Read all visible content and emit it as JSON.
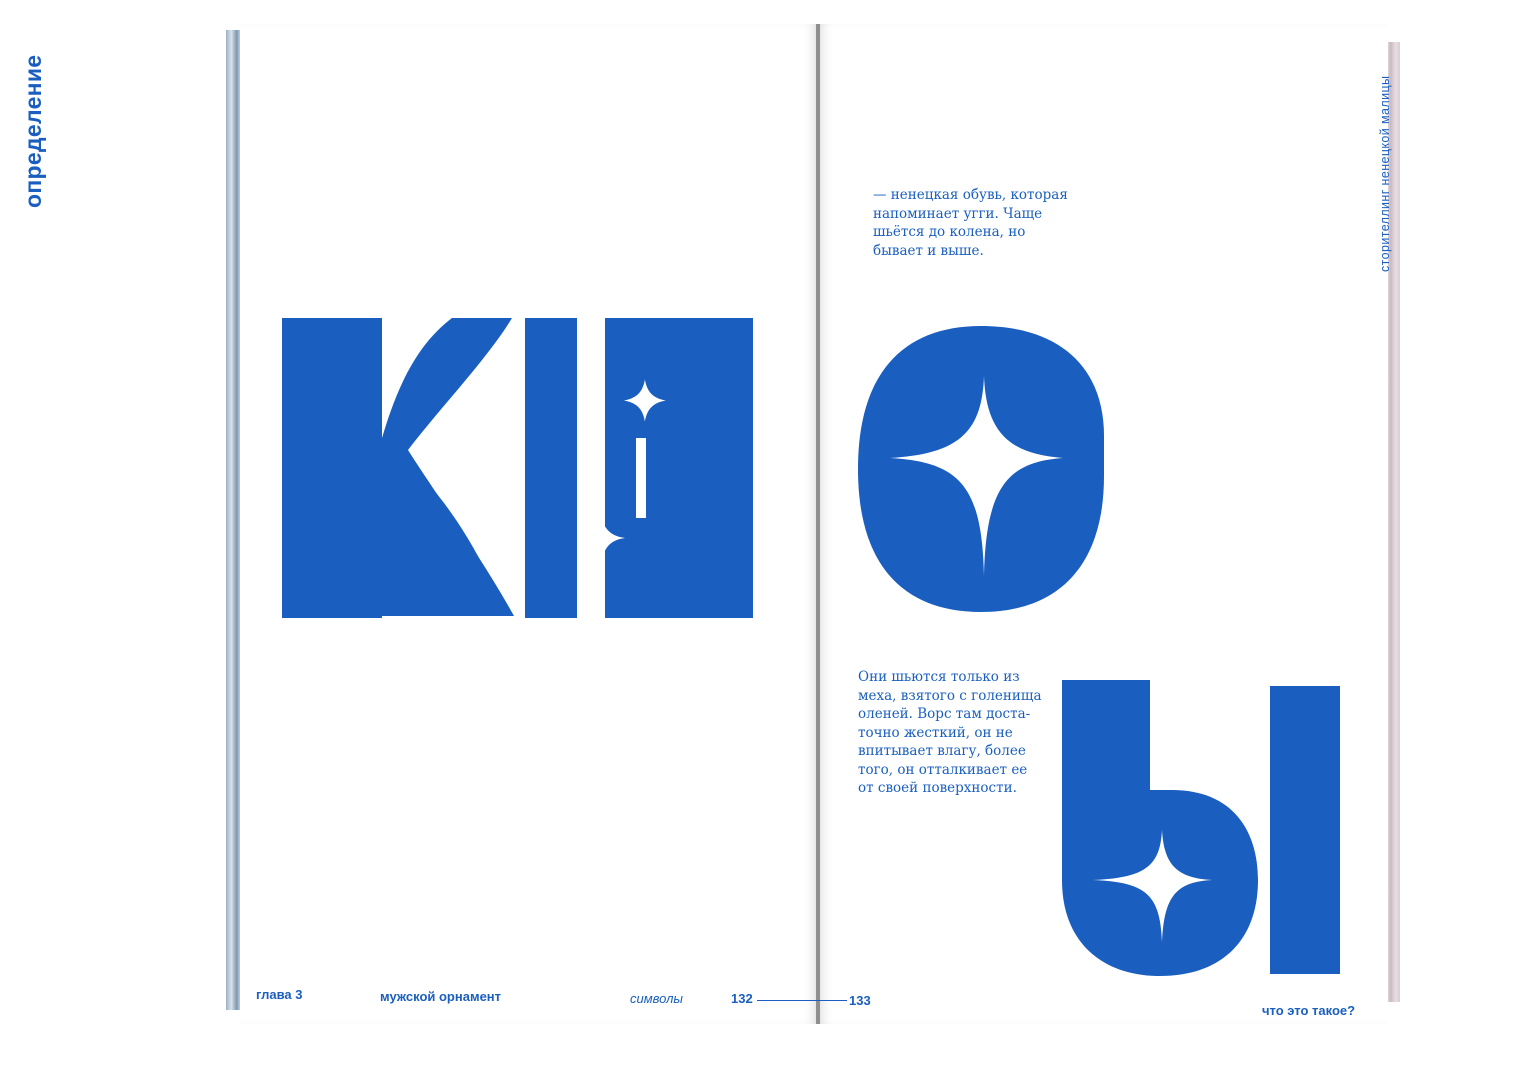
{
  "left_page": {
    "section_label": "определение",
    "footer": {
      "chapter": "глава 3",
      "topic": "мужской орнамент",
      "section": "символы",
      "page_number": "132"
    }
  },
  "right_page": {
    "side_label": "сторителлинг ненецкой малицы",
    "definition_lines": [
      "— ненецкая обувь, которая",
      "напоминает угги. Чаще",
      "шьётся до колена, но",
      "бывает и выше."
    ],
    "body_lines": [
      "Они шьются только из",
      "меха, взятого с голенища",
      "оленей. Ворс там доста-",
      "точно жесткий, он не",
      "впитывает влагу, более",
      "того, он отталкивает ее",
      "от своей поверхности."
    ],
    "footer": {
      "page_number": "133",
      "question": "что это такое?"
    }
  },
  "title_word": "кисы",
  "colors": {
    "ink_blue": "#1a5fbf",
    "paper": "#ffffff",
    "gutter": "#4a4a4a"
  }
}
